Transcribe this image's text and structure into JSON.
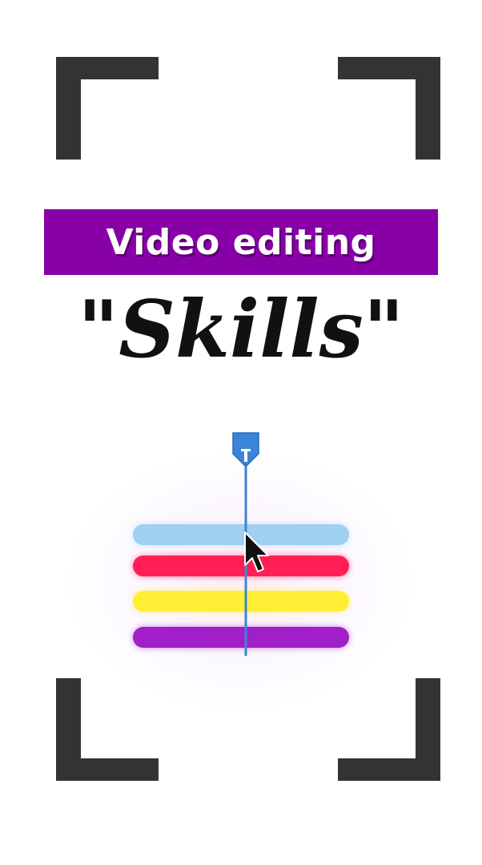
{
  "title": {
    "banner_text": "Video editing",
    "script_text": "\"Skills\""
  },
  "colors": {
    "frame_corners": "#333333",
    "banner_background": "#8800a8",
    "banner_text": "#ffffff",
    "script_text": "#111111",
    "playhead": "#3a85d8"
  },
  "timeline": {
    "tracks": [
      {
        "color": "#9fd0f2"
      },
      {
        "color": "#ff1f55"
      },
      {
        "color": "#ffee33"
      },
      {
        "color": "#a01fc8"
      }
    ]
  },
  "icons": {
    "playhead": "playhead-marker-icon",
    "cursor": "mouse-cursor-icon"
  }
}
